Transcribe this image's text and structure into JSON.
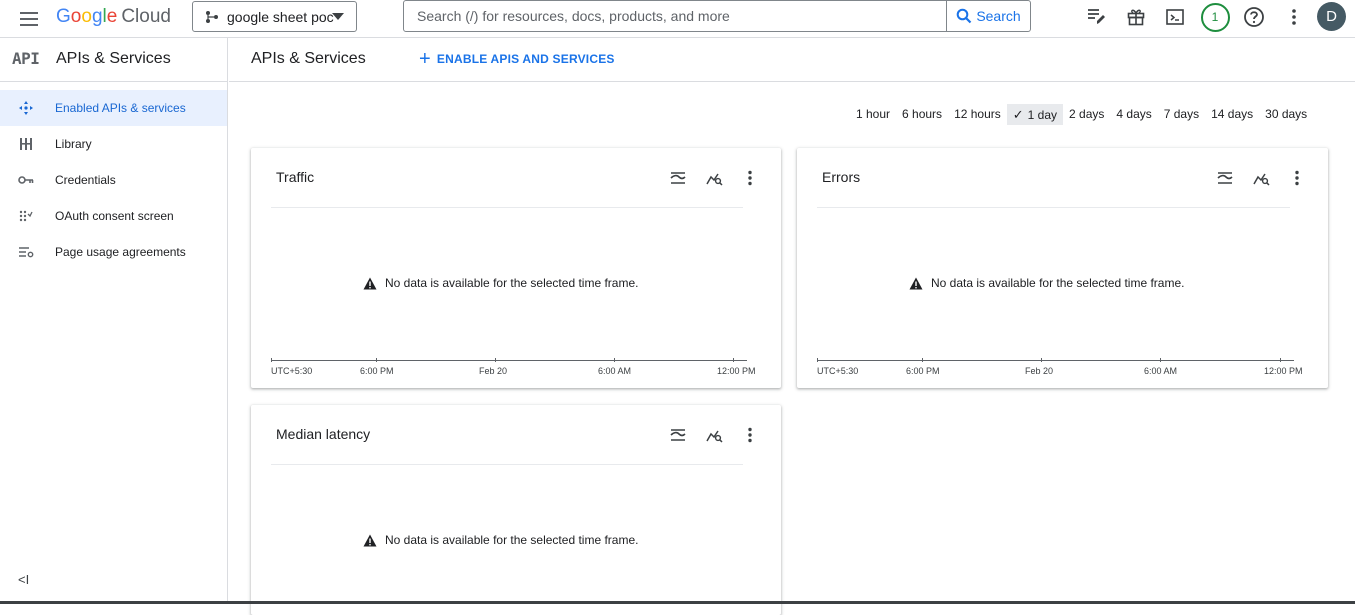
{
  "header": {
    "logo_google": "Google",
    "logo_cloud": "Cloud",
    "project": "google sheet poc",
    "search_placeholder": "Search (/) for resources, docs, products, and more",
    "search_button": "Search",
    "notification_count": "1",
    "avatar_letter": "D"
  },
  "sidebar": {
    "logo_text": "API",
    "title": "APIs & Services",
    "items": [
      {
        "label": "Enabled APIs & services",
        "icon": "diamond-arrows-icon",
        "active": true
      },
      {
        "label": "Library",
        "icon": "library-grid-icon",
        "active": false
      },
      {
        "label": "Credentials",
        "icon": "key-icon",
        "active": false
      },
      {
        "label": "OAuth consent screen",
        "icon": "consent-dots-icon",
        "active": false
      },
      {
        "label": "Page usage agreements",
        "icon": "list-settings-icon",
        "active": false
      }
    ],
    "collapse_label": "<I"
  },
  "main": {
    "title": "APIs & Services",
    "enable_button": "ENABLE APIS AND SERVICES",
    "timeframes": [
      "1 hour",
      "6 hours",
      "12 hours",
      "1 day",
      "2 days",
      "4 days",
      "7 days",
      "14 days",
      "30 days"
    ],
    "selected_timeframe": "1 day",
    "check_mark": "✓",
    "no_data_message": "No data is available for the selected time frame.",
    "axis_labels": [
      "UTC+5:30",
      "6:00 PM",
      "Feb 20",
      "6:00 AM",
      "12:00 PM"
    ],
    "cards": [
      {
        "title": "Traffic"
      },
      {
        "title": "Errors"
      },
      {
        "title": "Median latency"
      }
    ]
  },
  "colors": {
    "accent": "#1a73e8",
    "active_nav_bg": "#e8f0fe",
    "badge_green": "#1e8e3e",
    "avatar_bg": "#455a64"
  }
}
